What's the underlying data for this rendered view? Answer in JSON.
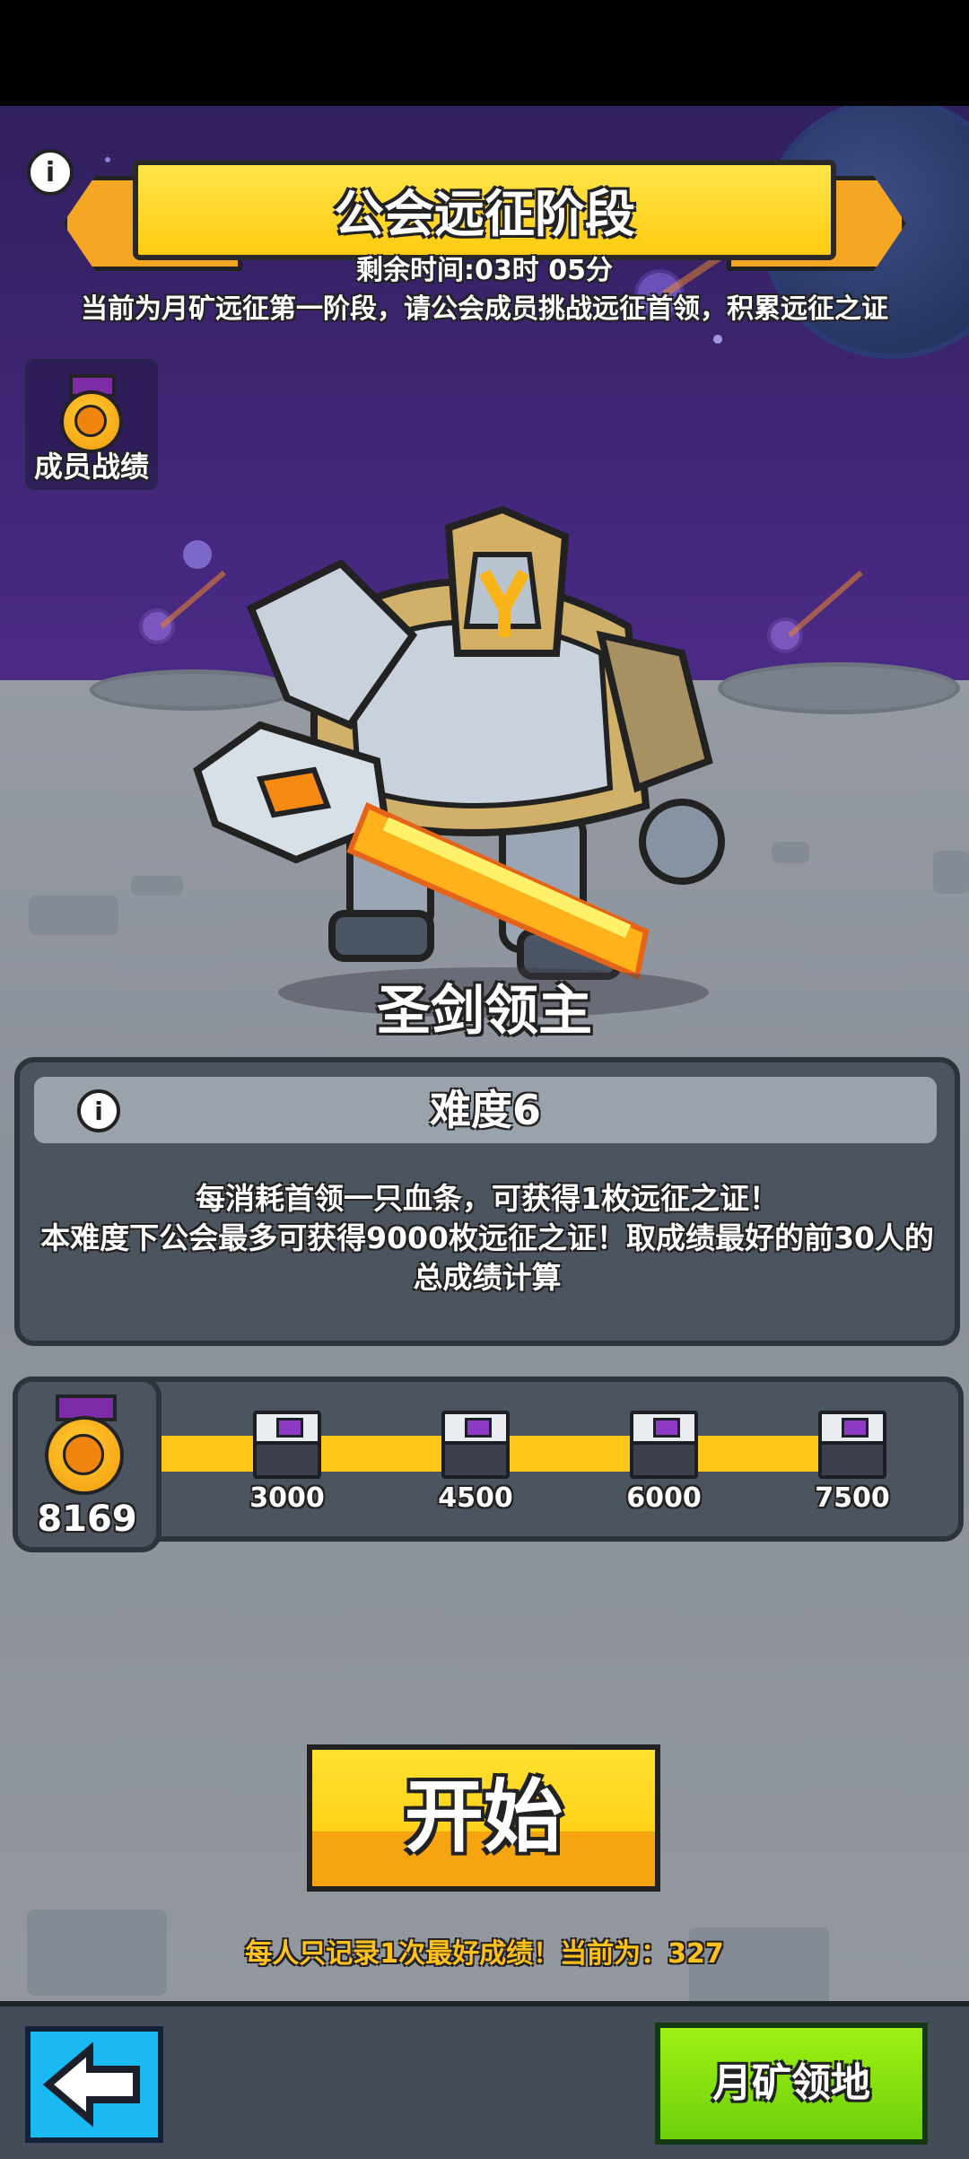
{
  "header": {
    "title": "公会远征阶段",
    "remaining_time": "剩余时间:03时 05分",
    "description": "当前为月矿远征第一阶段，请公会成员挑战远征首领，积累远征之证"
  },
  "member_record": {
    "label": "成员战绩"
  },
  "boss": {
    "name": "圣剑领主"
  },
  "difficulty": {
    "title": "难度6",
    "line1": "每消耗首领一只血条，可获得1枚远征之证！",
    "line2": "本难度下公会最多可获得9000枚远征之证！取成绩最好的前30人的总成绩计算"
  },
  "progress": {
    "current_score": "8169",
    "milestones": [
      "3000",
      "4500",
      "6000",
      "7500"
    ],
    "fill_fraction": 1.0
  },
  "actions": {
    "start_label": "开始",
    "note": "每人只记录1次最好成绩！当前为：327",
    "back_label": "",
    "mine_label": "月矿领地"
  },
  "colors": {
    "gold": "#ffcc11",
    "progress": "#ffc61a",
    "back_button": "#1bb9f2",
    "mine_button": "#7fdd0e"
  },
  "icons": {
    "info": "info-icon",
    "medal": "medal-icon",
    "chest": "treasure-chest-icon",
    "back": "back-arrow-icon"
  }
}
